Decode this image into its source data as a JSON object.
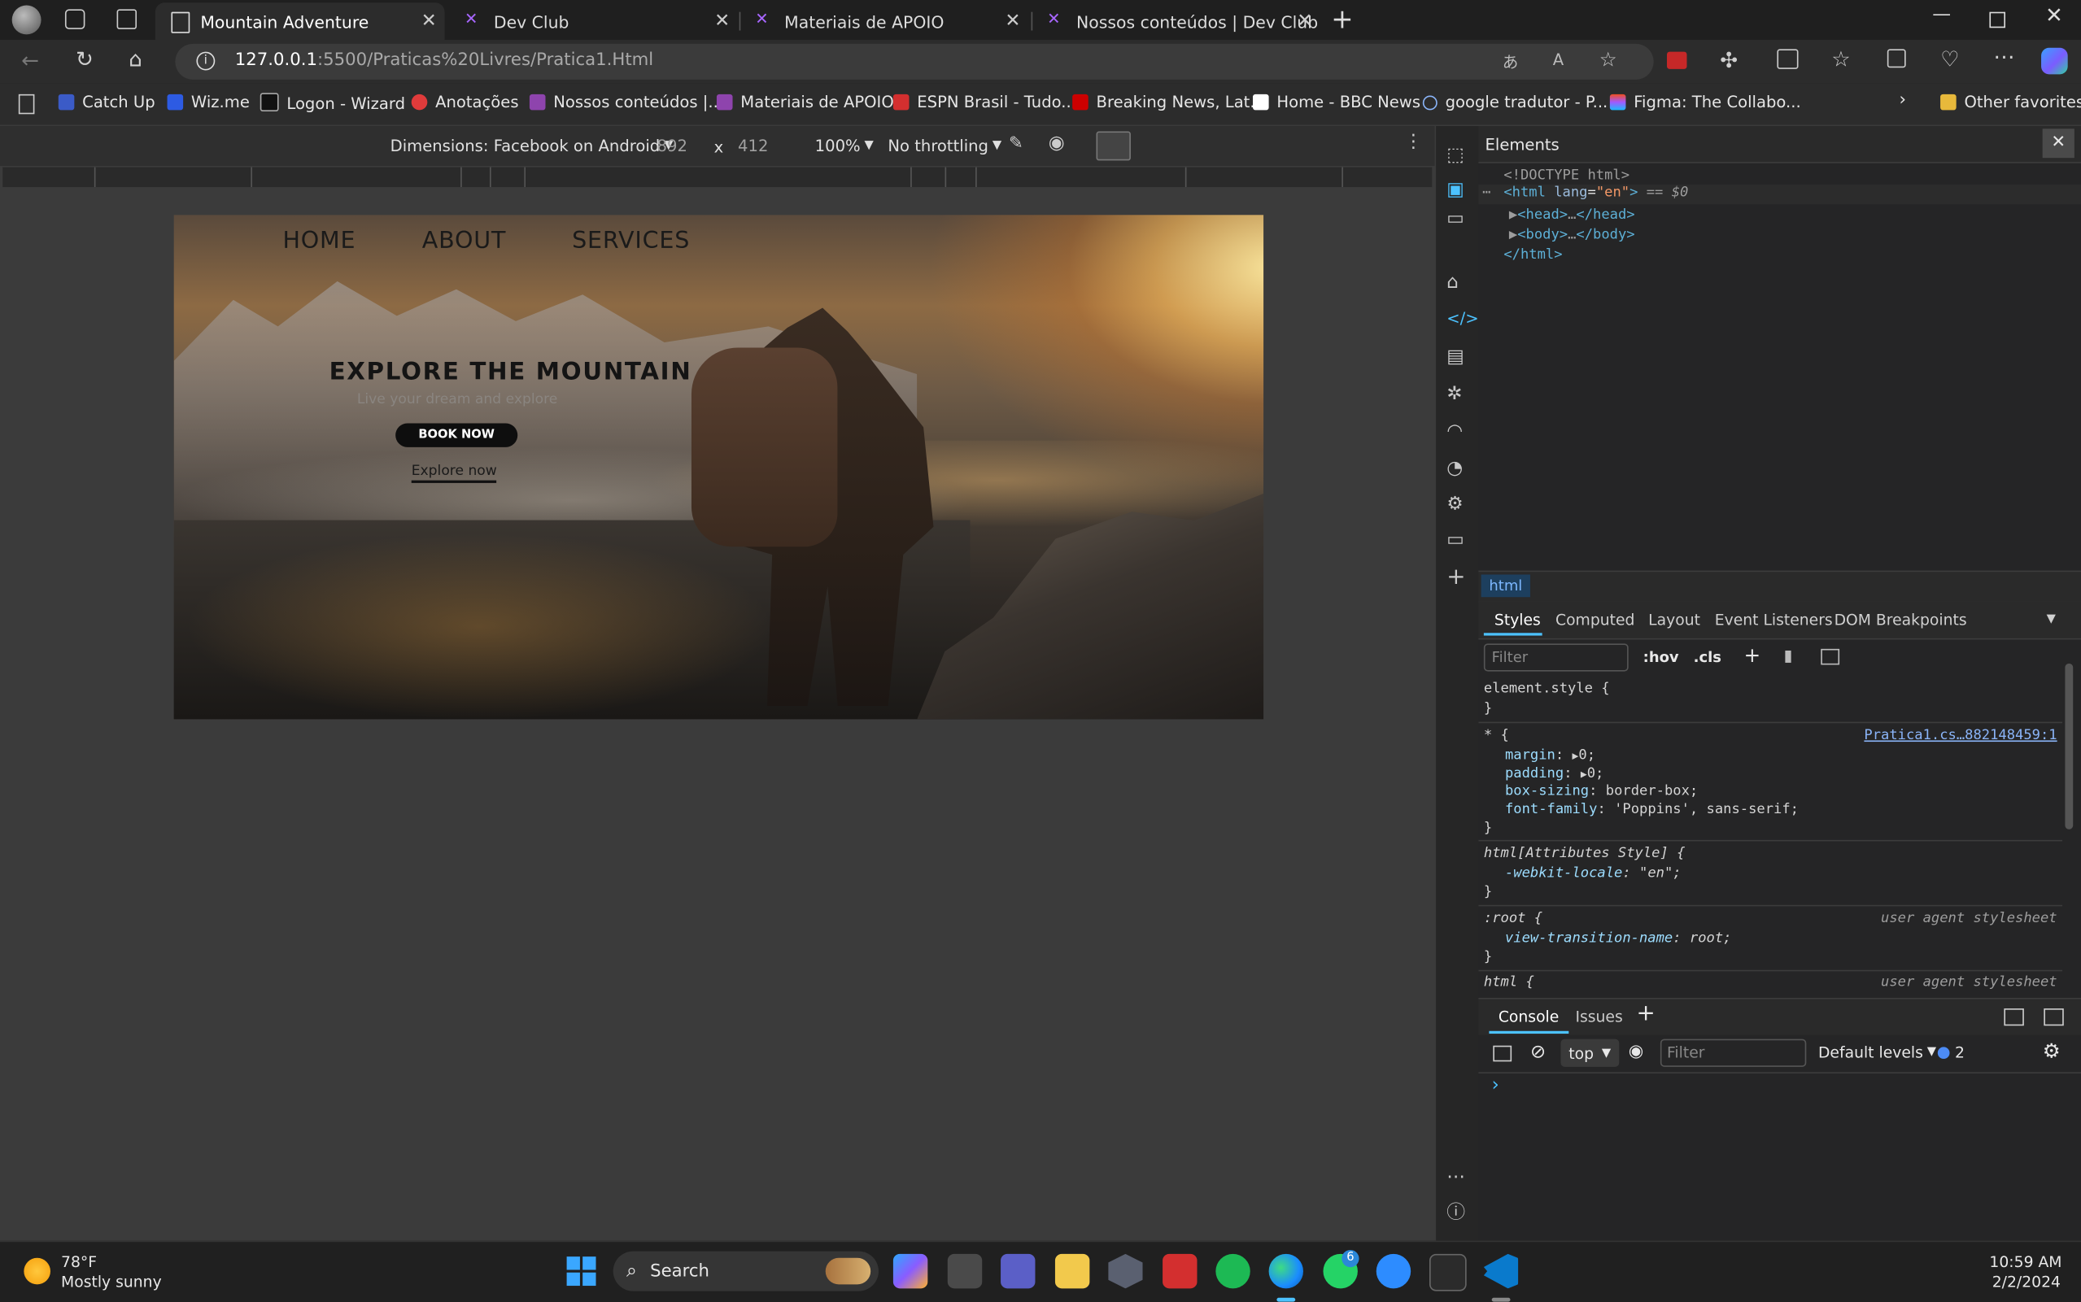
{
  "tabs": [
    {
      "label": "Mountain Adventure",
      "active": true
    },
    {
      "label": "Dev Club",
      "active": false
    },
    {
      "label": "Materiais de APOIO",
      "active": false
    },
    {
      "label": "Nossos conteúdos | Dev Club",
      "active": false
    }
  ],
  "address": {
    "host": "127.0.0.1",
    "path": ":5500/Praticas%20Livres/Pratica1.Html"
  },
  "bookmarks": [
    "Catch Up",
    "Wiz.me",
    "Logon - Wizard",
    "Anotações",
    "Nossos conteúdos |...",
    "Materiais de APOIO",
    "ESPN Brasil - Tudo...",
    "Breaking News, Lat...",
    "Home - BBC News",
    "google tradutor - P...",
    "Figma: The Collabo..."
  ],
  "other_favorites": "Other favorites",
  "device_toolbar": {
    "dimensions": "Dimensions: Facebook on Android",
    "width": "892",
    "x": "x",
    "height": "412",
    "zoom": "100%",
    "throttling": "No throttling"
  },
  "site": {
    "nav": [
      "HOME",
      "ABOUT",
      "SERVICES"
    ],
    "title": "EXPLORE THE MOUNTAIN",
    "subtitle": "Live your dream and explore",
    "cta": "BOOK NOW",
    "link": "Explore now"
  },
  "devtools": {
    "panel_title": "Elements",
    "dom": {
      "doctype": "<!DOCTYPE html>",
      "html_open": "<html",
      "lang_attr": "lang",
      "lang_val": "\"en\"",
      "html_close_bracket": ">",
      "eq_marker": "== $0",
      "head": "<head>",
      "head_close": "</head>",
      "body": "<body>",
      "body_close": "</body>",
      "html_end": "</html>",
      "ellipsis": "…"
    },
    "breadcrumb": "html",
    "style_tabs": [
      "Styles",
      "Computed",
      "Layout",
      "Event Listeners",
      "DOM Breakpoints"
    ],
    "filter_placeholder": "Filter",
    "hov": ":hov",
    "cls": ".cls",
    "rules": {
      "element_style": "element.style {",
      "close": "}",
      "star_open": "* {",
      "star_source": "Pratica1.cs…882148459:1",
      "margin_prop": "margin",
      "margin_val": "0;",
      "padding_prop": "padding",
      "padding_val": "0;",
      "box_prop": "box-sizing",
      "box_val": "border-box;",
      "font_prop": "font-family",
      "font_val": "'Poppins', sans-serif;",
      "attr_sel": "html[Attributes Style] {",
      "locale_prop": "-webkit-locale",
      "locale_val": "\"en\";",
      "root_sel": ":root {",
      "uas": "user agent stylesheet",
      "vt_prop": "view-transition-name",
      "vt_val": "root;",
      "html_sel": "html {"
    },
    "console_tabs": [
      "Console",
      "Issues"
    ],
    "console_context": "top",
    "console_filter": "Filter",
    "levels": "Default levels",
    "issues_count": "2",
    "prompt": "›"
  },
  "taskbar": {
    "temp": "78°F",
    "weather": "Mostly sunny",
    "search": "Search",
    "time": "10:59 AM",
    "date": "2/2/2024",
    "whatsapp_badge": "6"
  },
  "colors": {
    "accent": "#4cc2ff",
    "selected": "#1d3f5e"
  }
}
